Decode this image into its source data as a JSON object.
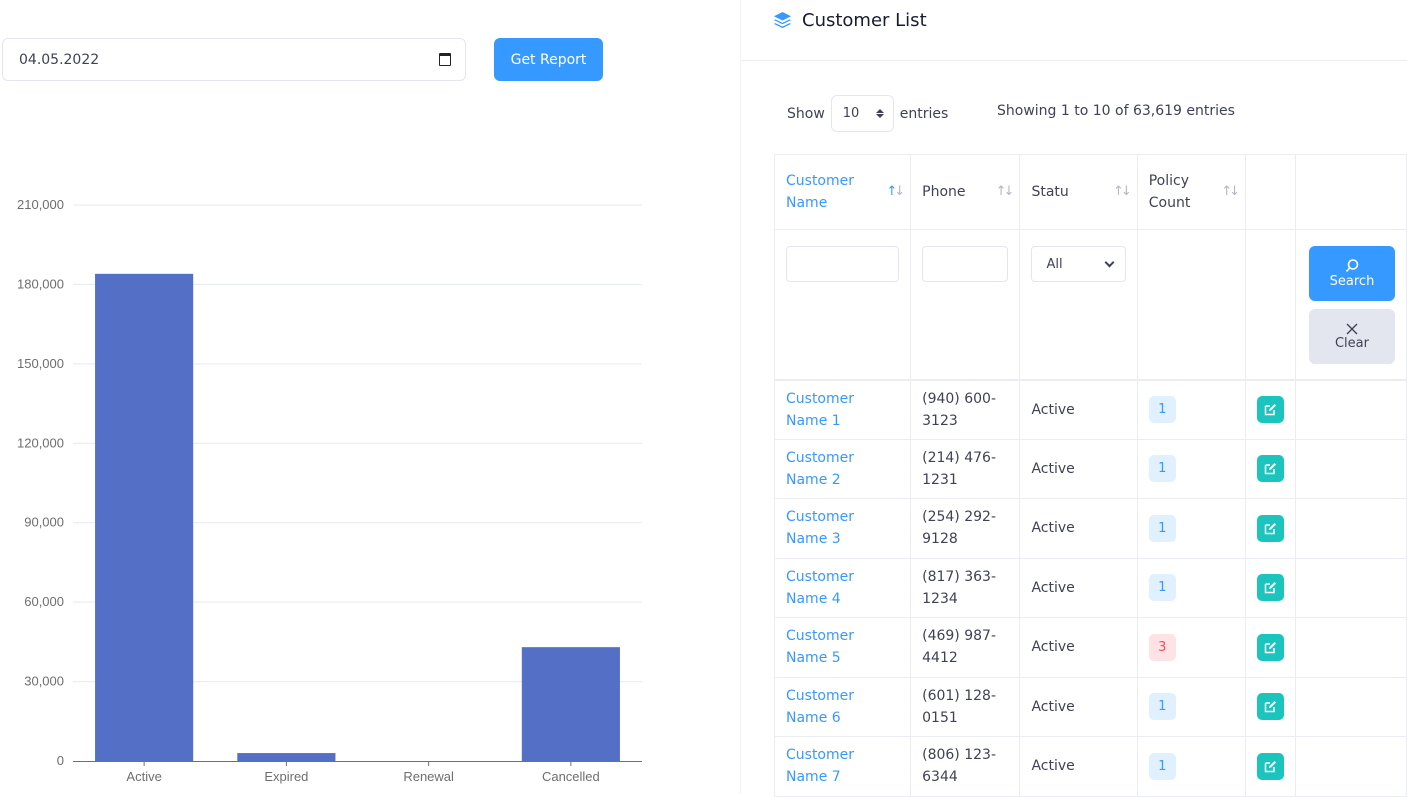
{
  "report": {
    "date_value": "04.05.2022",
    "get_report_label": "Get Report"
  },
  "chart_data": {
    "type": "bar",
    "title": "",
    "xlabel": "",
    "ylabel": "",
    "categories": [
      "Active",
      "Expired",
      "Renewal",
      "Cancelled"
    ],
    "values": [
      184000,
      3000,
      0,
      43000
    ],
    "ylim": [
      0,
      210000
    ],
    "yticks": [
      0,
      30000,
      60000,
      90000,
      120000,
      150000,
      180000,
      210000
    ],
    "ytick_labels": [
      "0",
      "30,000",
      "60,000",
      "90,000",
      "120,000",
      "150,000",
      "180,000",
      "210,000"
    ],
    "grid": true,
    "legend": "none",
    "bar_color": "#5470c6"
  },
  "customer_list": {
    "title": "Customer List",
    "title_icon": "layers-icon",
    "show_label": "Show",
    "page_length": "10",
    "entries_label": "entries",
    "info": "Showing 1 to 10 of 63,619 entries",
    "columns": [
      {
        "label": "Customer Name",
        "sorted": true
      },
      {
        "label": "Phone",
        "sorted": false
      },
      {
        "label": "Statu",
        "sorted": false
      },
      {
        "label": "Policy Count",
        "sorted": false
      }
    ],
    "filters": {
      "name_value": "",
      "phone_value": "",
      "status_value": "All",
      "search_label": "Search",
      "clear_label": "Clear"
    },
    "rows": [
      {
        "name": "Customer Name 1",
        "phone": "(940) 600-3123",
        "status": "Active",
        "policy_count": "1",
        "badge": "primary"
      },
      {
        "name": "Customer Name 2",
        "phone": "(214) 476-1231",
        "status": "Active",
        "policy_count": "1",
        "badge": "primary"
      },
      {
        "name": "Customer Name 3",
        "phone": "(254) 292-9128",
        "status": "Active",
        "policy_count": "1",
        "badge": "primary"
      },
      {
        "name": "Customer Name 4",
        "phone": "(817) 363-1234",
        "status": "Active",
        "policy_count": "1",
        "badge": "primary"
      },
      {
        "name": "Customer Name 5",
        "phone": "(469) 987-4412",
        "status": "Active",
        "policy_count": "3",
        "badge": "danger"
      },
      {
        "name": "Customer Name 6",
        "phone": "(601) 128-0151",
        "status": "Active",
        "policy_count": "1",
        "badge": "primary"
      },
      {
        "name": "Customer Name 7",
        "phone": "(806) 123-6344",
        "status": "Active",
        "policy_count": "1",
        "badge": "primary"
      }
    ]
  }
}
